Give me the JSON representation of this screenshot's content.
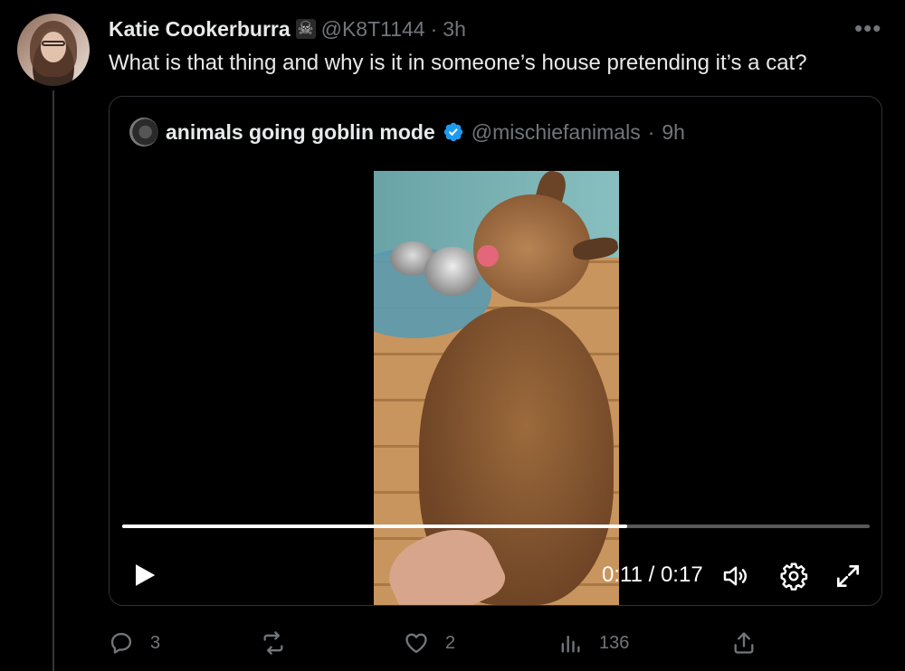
{
  "tweet": {
    "author_name": "Katie Cookerburra",
    "author_emoji": "☠",
    "author_handle": "@K8T1144",
    "separator": "·",
    "time": "3h",
    "more_label": "•••",
    "text": "What is that thing and why is it in someone’s house pretending it’s a cat?"
  },
  "quote": {
    "name": "animals going goblin mode",
    "handle": "@mischiefanimals",
    "separator": "·",
    "time": "9h",
    "verified": true
  },
  "video": {
    "current_time": "0:11",
    "duration": "0:17",
    "time_separator": " / ",
    "progress_fraction": 0.676
  },
  "actions": {
    "replies": "3",
    "retweets": "",
    "likes": "2",
    "views": "136"
  },
  "colors": {
    "background": "#000000",
    "text_primary": "#e7e9ea",
    "text_secondary": "#71767b",
    "verified_blue": "#1d9bf0",
    "border": "#2f3336"
  },
  "icons": {
    "reply": "reply-icon",
    "retweet": "retweet-icon",
    "like": "heart-icon",
    "views": "views-icon",
    "share": "share-icon",
    "play": "play-icon",
    "volume": "volume-icon",
    "settings": "gear-icon",
    "fullscreen": "fullscreen-icon"
  }
}
